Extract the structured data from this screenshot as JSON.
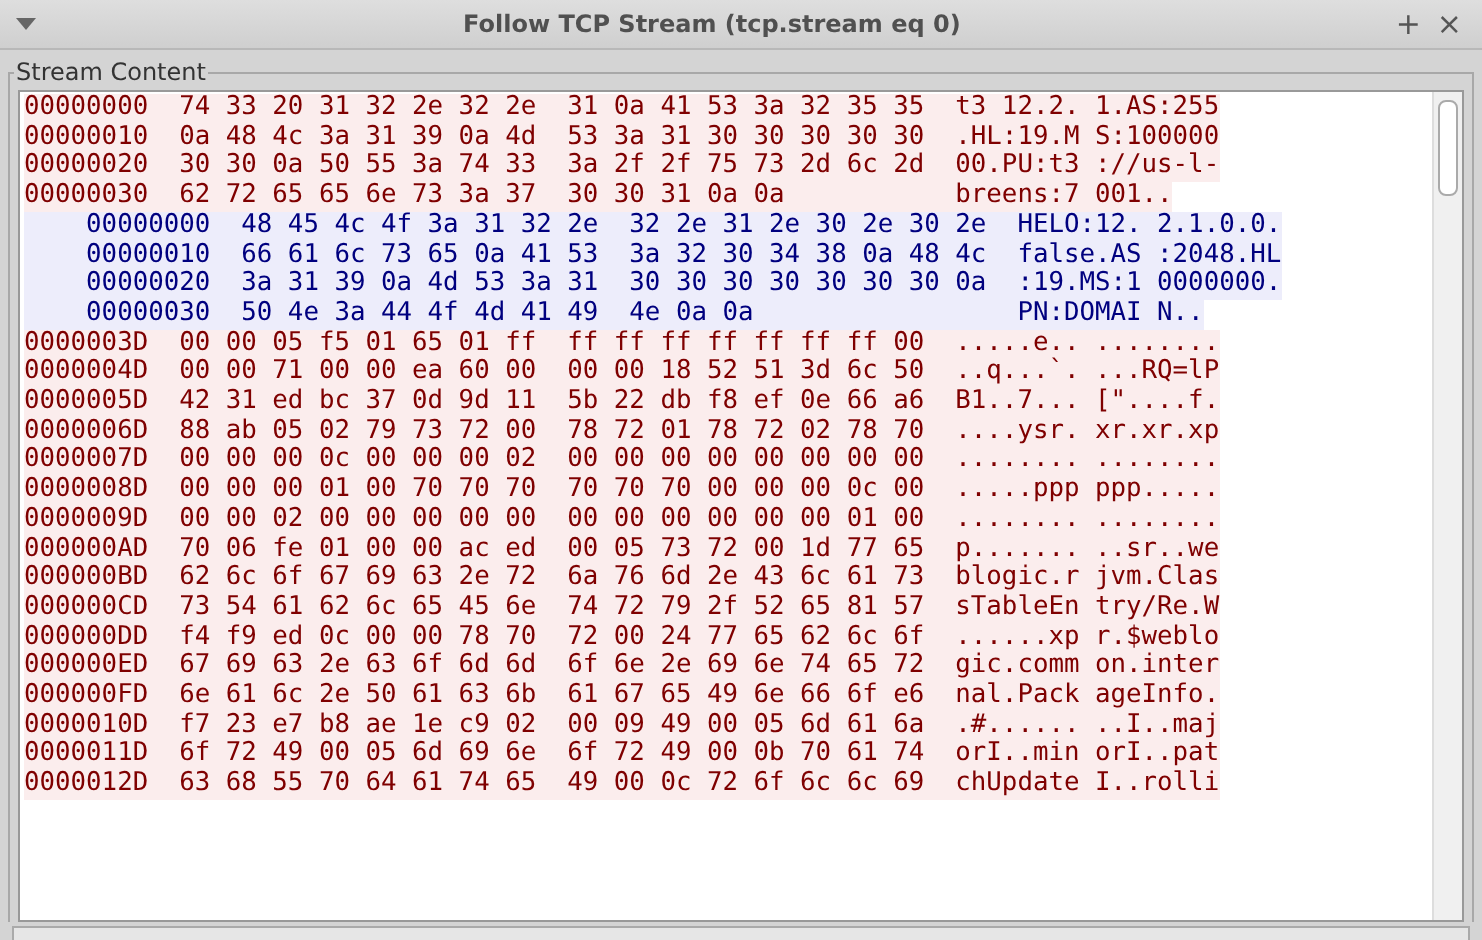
{
  "window": {
    "title": "Follow TCP Stream (tcp.stream eq 0)",
    "controls": [
      "+",
      "×"
    ]
  },
  "group": {
    "label": "Stream Content"
  },
  "rows": [
    {
      "kind": "client",
      "text": "00000000  74 33 20 31 32 2e 32 2e  31 0a 41 53 3a 32 35 35  t3 12.2. 1.AS:255"
    },
    {
      "kind": "client",
      "text": "00000010  0a 48 4c 3a 31 39 0a 4d  53 3a 31 30 30 30 30 30  .HL:19.M S:100000"
    },
    {
      "kind": "client",
      "text": "00000020  30 30 0a 50 55 3a 74 33  3a 2f 2f 75 73 2d 6c 2d  00.PU:t3 ://us-l-"
    },
    {
      "kind": "client",
      "text": "00000030  62 72 65 65 6e 73 3a 37  30 30 31 0a 0a           breens:7 001.."
    },
    {
      "kind": "server",
      "text": "    00000000  48 45 4c 4f 3a 31 32 2e  32 2e 31 2e 30 2e 30 2e  HELO:12. 2.1.0.0."
    },
    {
      "kind": "server",
      "text": "    00000010  66 61 6c 73 65 0a 41 53  3a 32 30 34 38 0a 48 4c  false.AS :2048.HL"
    },
    {
      "kind": "server",
      "text": "    00000020  3a 31 39 0a 4d 53 3a 31  30 30 30 30 30 30 30 0a  :19.MS:1 0000000."
    },
    {
      "kind": "server",
      "text": "    00000030  50 4e 3a 44 4f 4d 41 49  4e 0a 0a                 PN:DOMAI N.."
    },
    {
      "kind": "client",
      "text": "0000003D  00 00 05 f5 01 65 01 ff  ff ff ff ff ff ff ff 00  .....e.. ........"
    },
    {
      "kind": "client",
      "text": "0000004D  00 00 71 00 00 ea 60 00  00 00 18 52 51 3d 6c 50  ..q...`. ...RQ=lP"
    },
    {
      "kind": "client",
      "text": "0000005D  42 31 ed bc 37 0d 9d 11  5b 22 db f8 ef 0e 66 a6  B1..7... [\"....f."
    },
    {
      "kind": "client",
      "text": "0000006D  88 ab 05 02 79 73 72 00  78 72 01 78 72 02 78 70  ....ysr. xr.xr.xp"
    },
    {
      "kind": "client",
      "text": "0000007D  00 00 00 0c 00 00 00 02  00 00 00 00 00 00 00 00  ........ ........"
    },
    {
      "kind": "client",
      "text": "0000008D  00 00 00 01 00 70 70 70  70 70 70 00 00 00 0c 00  .....ppp ppp....."
    },
    {
      "kind": "client",
      "text": "0000009D  00 00 02 00 00 00 00 00  00 00 00 00 00 00 01 00  ........ ........"
    },
    {
      "kind": "client",
      "text": "000000AD  70 06 fe 01 00 00 ac ed  00 05 73 72 00 1d 77 65  p....... ..sr..we"
    },
    {
      "kind": "client",
      "text": "000000BD  62 6c 6f 67 69 63 2e 72  6a 76 6d 2e 43 6c 61 73  blogic.r jvm.Clas"
    },
    {
      "kind": "client",
      "text": "000000CD  73 54 61 62 6c 65 45 6e  74 72 79 2f 52 65 81 57  sTableEn try/Re.W"
    },
    {
      "kind": "client",
      "text": "000000DD  f4 f9 ed 0c 00 00 78 70  72 00 24 77 65 62 6c 6f  ......xp r.$weblo"
    },
    {
      "kind": "client",
      "text": "000000ED  67 69 63 2e 63 6f 6d 6d  6f 6e 2e 69 6e 74 65 72  gic.comm on.inter"
    },
    {
      "kind": "client",
      "text": "000000FD  6e 61 6c 2e 50 61 63 6b  61 67 65 49 6e 66 6f e6  nal.Pack ageInfo."
    },
    {
      "kind": "client",
      "text": "0000010D  f7 23 e7 b8 ae 1e c9 02  00 09 49 00 05 6d 61 6a  .#...... ..I..maj"
    },
    {
      "kind": "client",
      "text": "0000011D  6f 72 49 00 05 6d 69 6e  6f 72 49 00 0b 70 61 74  orI..min orI..pat"
    },
    {
      "kind": "client",
      "text": "0000012D  63 68 55 70 64 61 74 65  49 00 0c 72 6f 6c 6c 69  chUpdate I..rolli"
    }
  ]
}
